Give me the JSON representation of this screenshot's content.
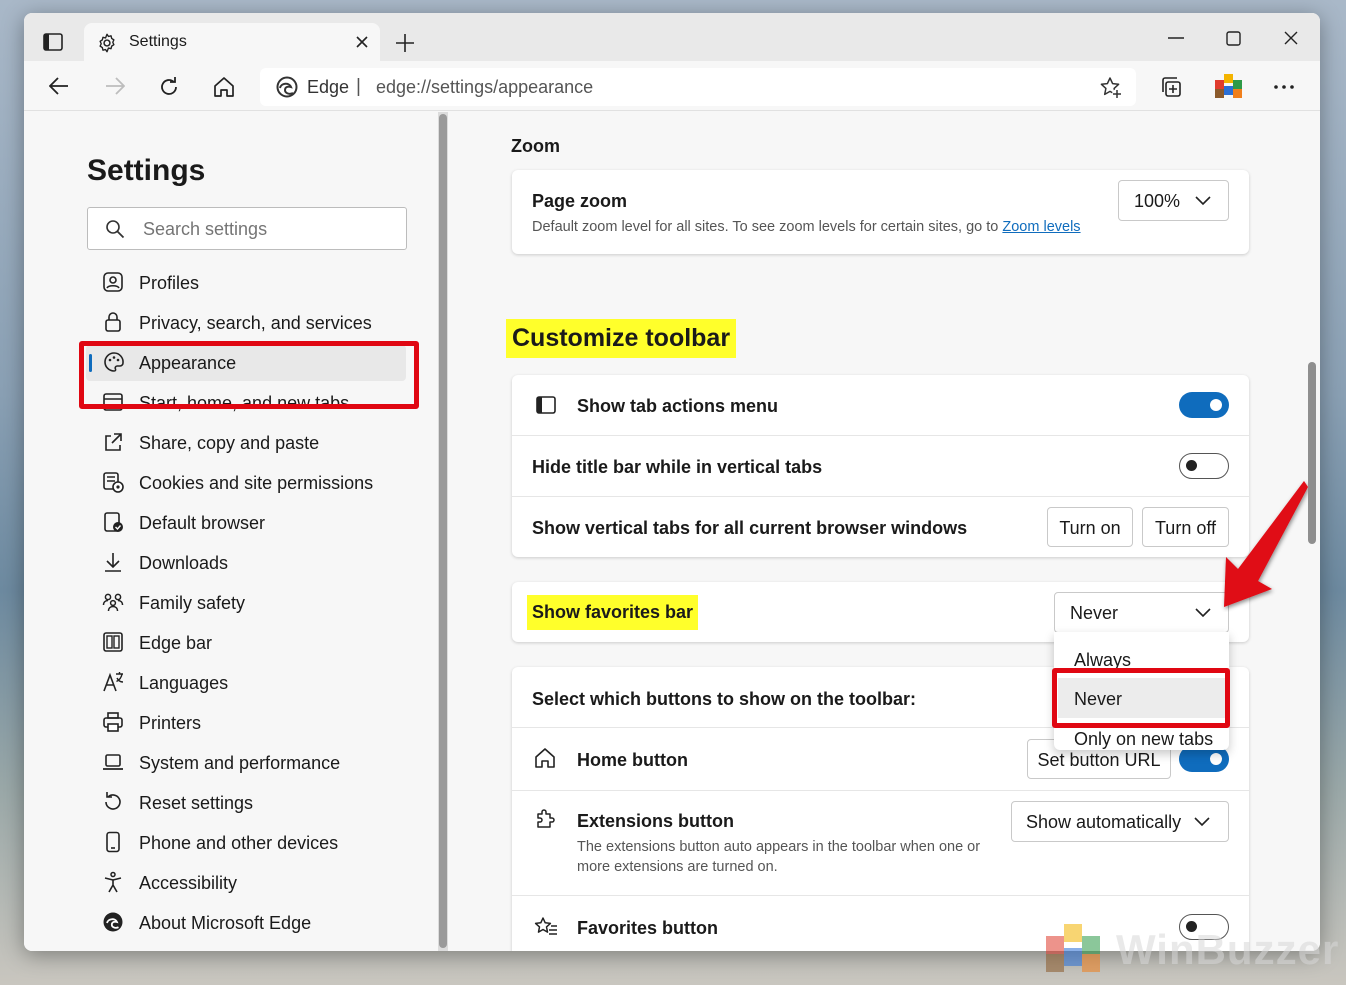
{
  "tab": {
    "title": "Settings"
  },
  "address": {
    "brand": "Edge",
    "separator": "|",
    "url": "edge://settings/appearance"
  },
  "sidebar": {
    "title": "Settings",
    "search_placeholder": "Search settings",
    "items": [
      {
        "label": "Profiles",
        "icon": "profile-icon"
      },
      {
        "label": "Privacy, search, and services",
        "icon": "lock-icon"
      },
      {
        "label": "Appearance",
        "icon": "palette-icon",
        "selected": true
      },
      {
        "label": "Start, home, and new tabs",
        "icon": "home-tabs-icon"
      },
      {
        "label": "Share, copy and paste",
        "icon": "share-icon"
      },
      {
        "label": "Cookies and site permissions",
        "icon": "cookies-icon"
      },
      {
        "label": "Default browser",
        "icon": "default-browser-icon"
      },
      {
        "label": "Downloads",
        "icon": "download-icon"
      },
      {
        "label": "Family safety",
        "icon": "family-icon"
      },
      {
        "label": "Edge bar",
        "icon": "edge-bar-icon"
      },
      {
        "label": "Languages",
        "icon": "languages-icon"
      },
      {
        "label": "Printers",
        "icon": "printer-icon"
      },
      {
        "label": "System and performance",
        "icon": "laptop-icon"
      },
      {
        "label": "Reset settings",
        "icon": "reset-icon"
      },
      {
        "label": "Phone and other devices",
        "icon": "phone-icon"
      },
      {
        "label": "Accessibility",
        "icon": "accessibility-icon"
      },
      {
        "label": "About Microsoft Edge",
        "icon": "edge-logo-icon"
      }
    ]
  },
  "zoom": {
    "heading": "Zoom",
    "title": "Page zoom",
    "desc": "Default zoom level for all sites. To see zoom levels for certain sites, go to",
    "link": "Zoom levels",
    "value": "100%"
  },
  "toolbar_section": {
    "heading": "Customize toolbar",
    "tab_actions": "Show tab actions menu",
    "hide_title": "Hide title bar while in vertical tabs",
    "vertical_tabs": "Show vertical tabs for all current browser windows",
    "turn_on": "Turn on",
    "turn_off": "Turn off",
    "favorites_bar": "Show favorites bar",
    "favorites_value": "Never",
    "dropdown_options": [
      "Always",
      "Never",
      "Only on new tabs"
    ],
    "select_buttons": "Select which buttons to show on the toolbar:",
    "home_button": "Home button",
    "set_button_url": "Set button URL",
    "extensions_button": "Extensions button",
    "extensions_desc_1": "The extensions button auto appears in the toolbar when one or",
    "extensions_desc_2": "more extensions are turned on.",
    "extensions_value": "Show automatically",
    "favorites_button": "Favorites button"
  },
  "states": {
    "tab_actions": true,
    "hide_title": false,
    "home_button": true,
    "favorites_button": false
  },
  "colors": {
    "accent": "#0f6cbd",
    "highlight": "#ffff2b",
    "annotation_red": "#e00712"
  },
  "watermark": "WinBuzzer"
}
